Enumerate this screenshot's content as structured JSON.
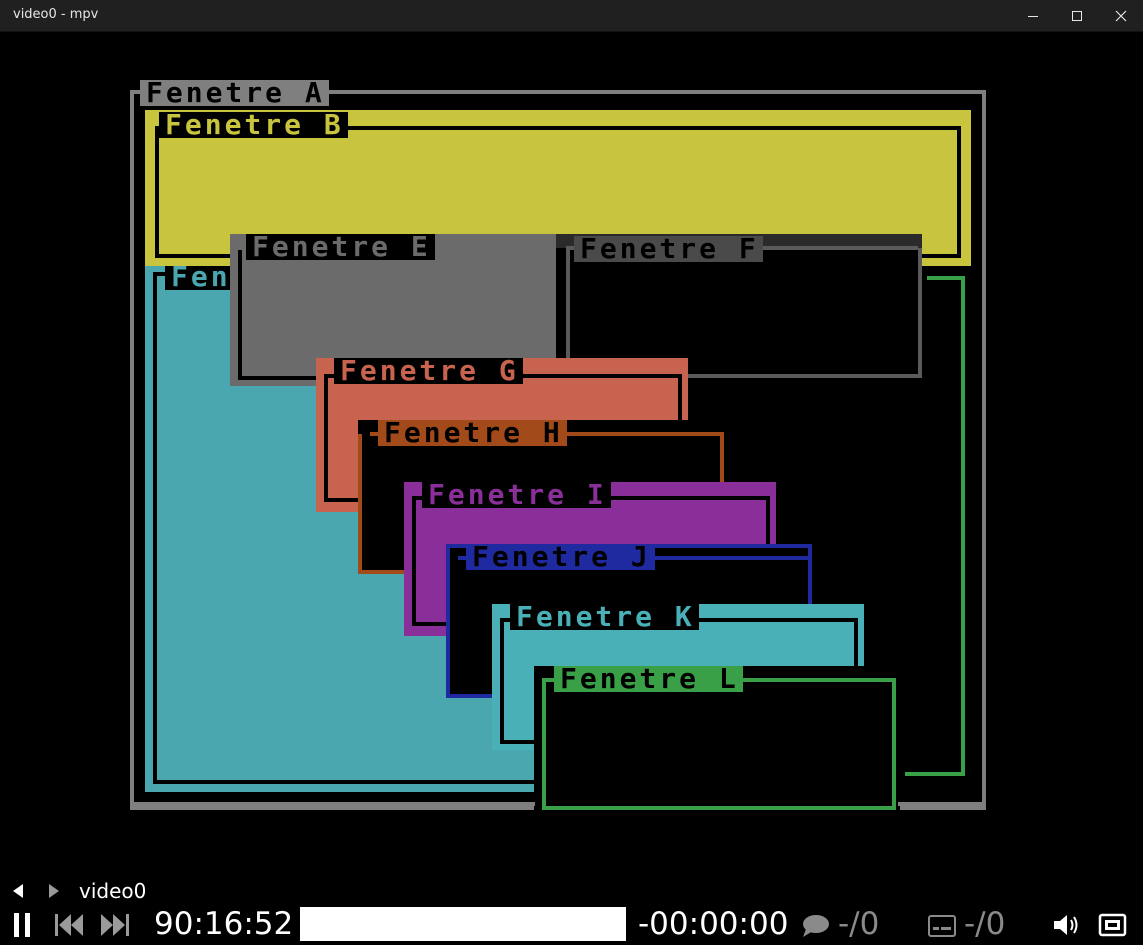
{
  "window": {
    "title": "video0 - mpv"
  },
  "controls": {
    "playlist_title": "video0",
    "elapsed": "90:16:52",
    "remaining": "-00:00:00",
    "subtitle_track": "-/0",
    "audio_track": "-/0",
    "seek_progress": 1.0
  },
  "video": {
    "windows": [
      {
        "id": "a",
        "title": "Fenetre A",
        "color": "#7f7f7f"
      },
      {
        "id": "b",
        "title": "Fenetre B",
        "color": "#c8c43e"
      },
      {
        "id": "c",
        "title": "Fen",
        "color": "#4aa7b0"
      },
      {
        "id": "d",
        "title": "",
        "color": "#3aa048"
      },
      {
        "id": "e",
        "title": "Fenetre E",
        "color": "#6b6b6b"
      },
      {
        "id": "f",
        "title": "Fenetre F",
        "color": "#5a5a5a"
      },
      {
        "id": "g",
        "title": "Fenetre G",
        "color": "#c8634f"
      },
      {
        "id": "h",
        "title": "Fenetre H",
        "color": "#a34a1a"
      },
      {
        "id": "i",
        "title": "Fenetre I",
        "color": "#8a2f9a"
      },
      {
        "id": "j",
        "title": "Fenetre J",
        "color": "#1f2aa0"
      },
      {
        "id": "k",
        "title": "Fenetre K",
        "color": "#4ab0b8"
      },
      {
        "id": "l",
        "title": "Fenetre L",
        "color": "#3aa048"
      }
    ]
  },
  "icons": {
    "minimize": "minimize-icon",
    "maximize": "maximize-icon",
    "close": "close-icon",
    "prev_playlist": "triangle-left-icon",
    "next_playlist": "triangle-right-icon",
    "pause": "pause-icon",
    "skip_back": "skip-back-icon",
    "skip_forward": "skip-forward-icon",
    "subtitles": "speech-bubble-icon",
    "audio": "keyboard-icon",
    "volume": "speaker-icon",
    "fullscreen": "fullscreen-icon"
  }
}
